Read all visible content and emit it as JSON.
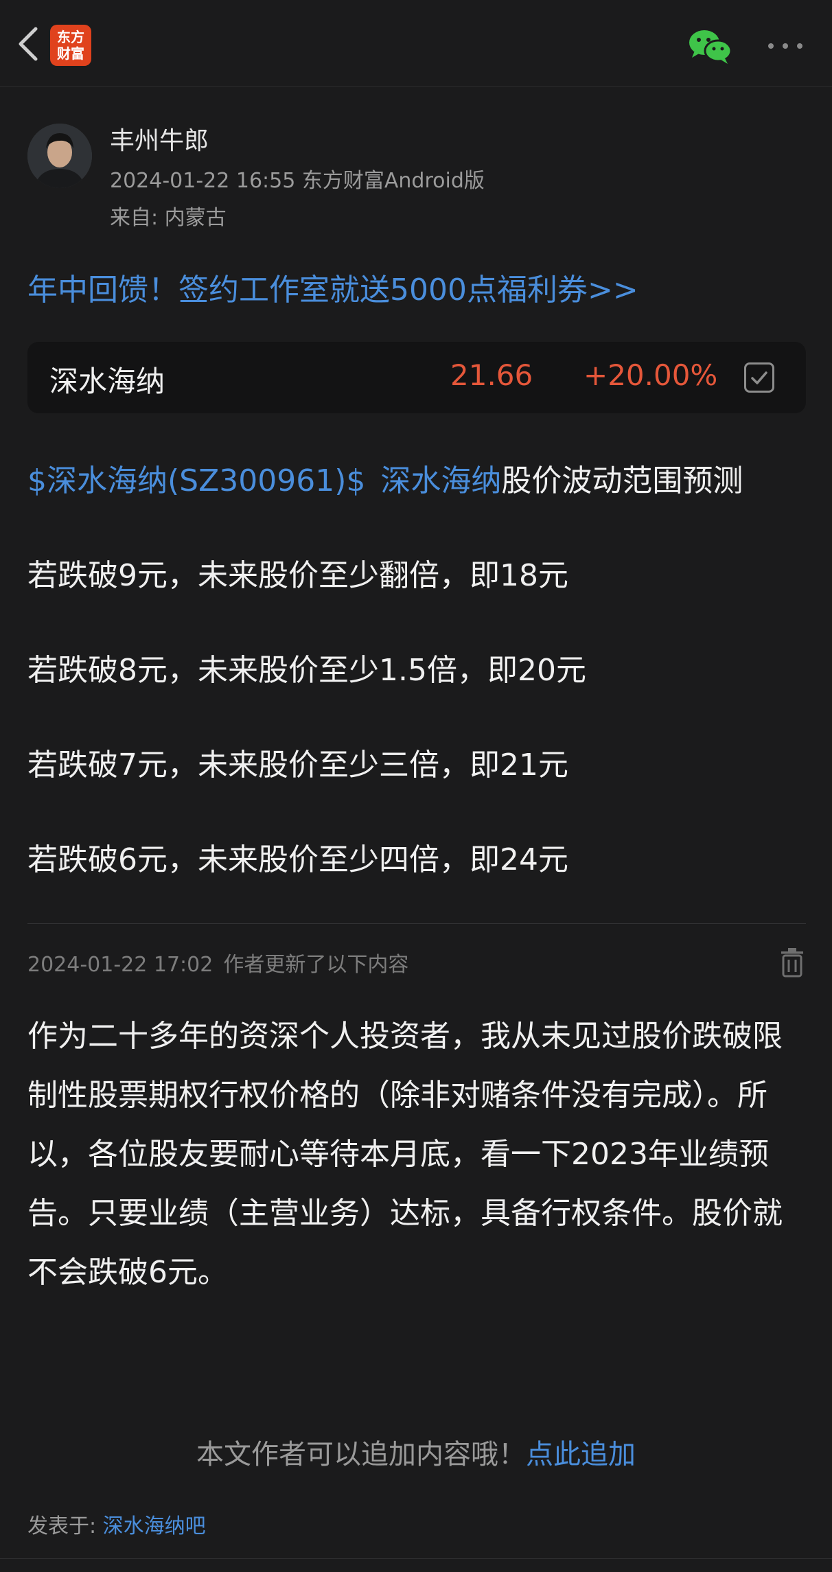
{
  "header": {
    "logo_line1": "东方",
    "logo_line2": "财富"
  },
  "author": {
    "name": "丰州牛郎",
    "meta": "2024-01-22 16:55 东方财富Android版",
    "from": "来自: 内蒙古"
  },
  "promo": "年中回馈！签约工作室就送5000点福利券>>",
  "stock": {
    "name": "深水海纳",
    "price": "21.66",
    "change": "+20.00%"
  },
  "post": {
    "tag": "$深水海纳(SZ300961)$",
    "tag_name": "深水海纳",
    "title_rest": "股价波动范围预测",
    "lines": [
      "若跌破9元，未来股价至少翻倍，即18元",
      "若跌破8元，未来股价至少1.5倍，即20元",
      "若跌破7元，未来股价至少三倍，即21元",
      "若跌破6元，未来股价至少四倍，即24元"
    ]
  },
  "update": {
    "date": "2024-01-22 17:02",
    "label": "作者更新了以下内容",
    "text": "作为二十多年的资深个人投资者，我从未见过股价跌破限制性股票期权行权价格的（除非对赌条件没有完成）。所以，各位股友要耐心等待本月底，看一下2023年业绩预告。只要业绩（主营业务）达标，具备行权条件。股价就不会跌破6元。"
  },
  "footer": {
    "add_text": "本文作者可以追加内容哦！",
    "add_link": "点此追加",
    "posted_in_label": "发表于:",
    "posted_in_link": "深水海纳吧"
  },
  "colors": {
    "background": "#1b1b1c",
    "link": "#4a8edc",
    "rise": "#e5573a",
    "brand": "#e0421d",
    "wechat": "#3fc449"
  }
}
